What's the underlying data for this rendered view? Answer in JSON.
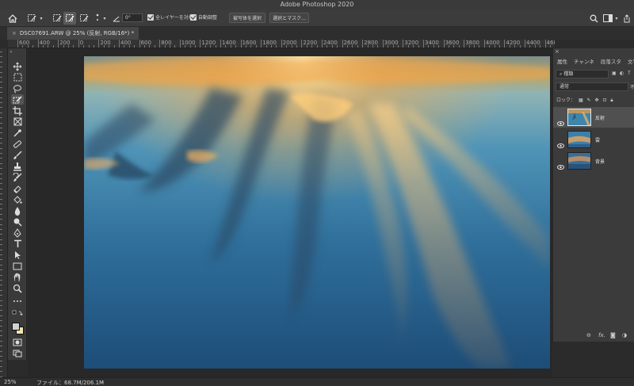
{
  "window": {
    "title": "Adobe Photoshop 2020"
  },
  "options_bar": {
    "angle_value": "0°",
    "sample_all_layers_label": "全レイヤーを対象",
    "auto_enhance_label": "自動調整",
    "select_subject_label": "被写体を選択",
    "select_mask_label": "選択とマスク..."
  },
  "document": {
    "tab_title": "DSC07691.ARW @ 25% (反射, RGB/16*) *"
  },
  "ruler": {
    "h_labels": [
      "600",
      "400",
      "200",
      "0",
      "200",
      "400",
      "600",
      "800",
      "1000",
      "1200",
      "1400",
      "1600",
      "1800",
      "2000",
      "2200",
      "2400",
      "2600",
      "2800",
      "3000",
      "3200",
      "3400",
      "3600",
      "3800",
      "4000",
      "4200",
      "4400",
      "4600",
      "4800"
    ]
  },
  "layers_panel": {
    "tabs": [
      "属性",
      "チャンネ",
      "段落スタ",
      "文字スタ"
    ],
    "filter_label": "種類",
    "blend_mode": "通常",
    "opacity_stub": "不",
    "lock_label": "ロック：",
    "layers": [
      {
        "name": "反射",
        "selected": true
      },
      {
        "name": "雲",
        "selected": false
      },
      {
        "name": "背景",
        "selected": false
      }
    ],
    "footer_fx": "fx."
  },
  "status": {
    "zoom": "25%",
    "file_info": "ファイル：68.7M/206.1M",
    "arrow": "›"
  },
  "colors": {
    "foreground": "#d2d2d2",
    "background": "#f3e3b0",
    "panel": "#3b3b3b",
    "workspace": "#282828"
  },
  "icons": [
    "home-icon",
    "brush-preset-icon",
    "new-selection-icon",
    "add-selection-icon",
    "subtract-selection-icon",
    "brush-size-icon",
    "angle-icon",
    "search-icon",
    "workspace-icon",
    "share-icon",
    "eye-icon",
    "link-icon",
    "fx-icon",
    "mask-icon",
    "adjustment-icon"
  ]
}
